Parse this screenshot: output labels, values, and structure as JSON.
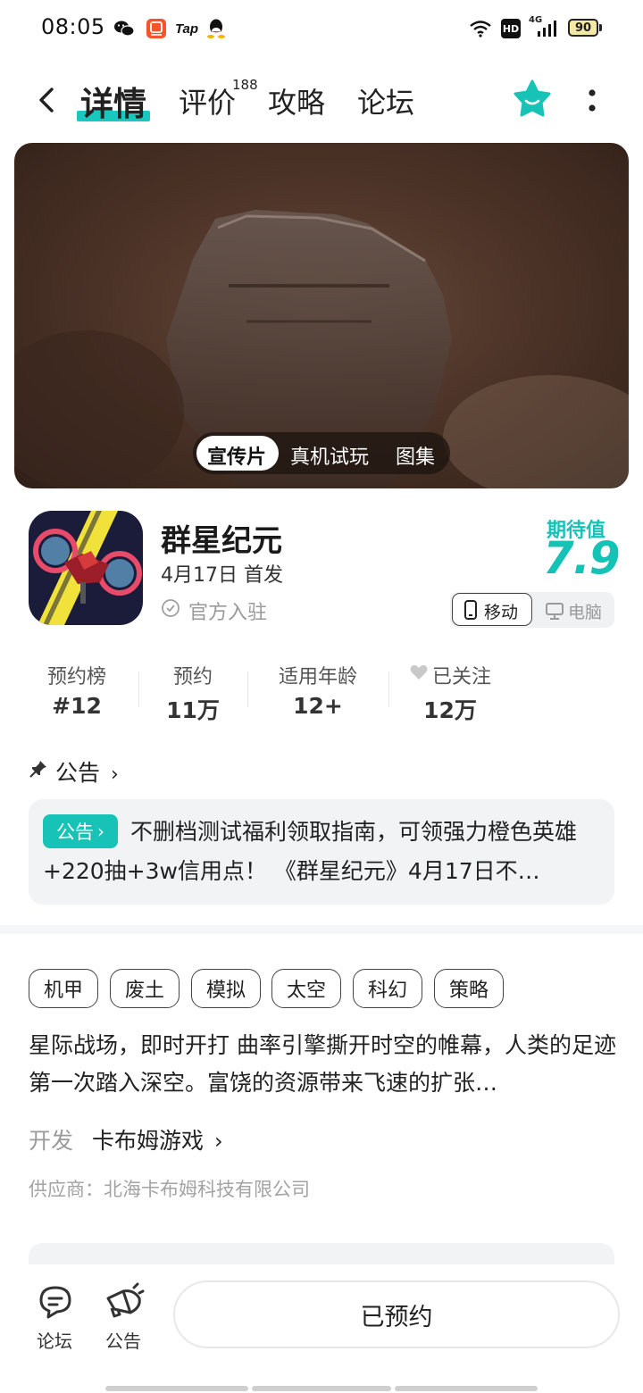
{
  "status_bar": {
    "time": "08:05",
    "left_icons": [
      "wechat-icon",
      "app-badge-icon",
      "tap-icon",
      "qq-icon"
    ],
    "tap_label": "Tap",
    "right_icons": [
      "wifi-icon",
      "hd-icon",
      "signal-4g-icon",
      "battery-icon"
    ],
    "hd_label": "HD",
    "network_label": "4G",
    "battery_level": "90"
  },
  "nav": {
    "tabs": [
      {
        "label": "详情",
        "active": true
      },
      {
        "label": "评价",
        "badge": "188"
      },
      {
        "label": "攻略"
      },
      {
        "label": "论坛"
      }
    ],
    "accent_color": "#18c7bd"
  },
  "media": {
    "tabs": [
      "宣传片",
      "真机试玩",
      "图集"
    ],
    "active_index": 0
  },
  "game": {
    "name": "群星纪元",
    "release": "4月17日 首发",
    "official": "官方入驻",
    "expectation_label": "期待值",
    "expectation_score": "7.9",
    "platforms": [
      {
        "label": "移动",
        "icon": "phone-icon",
        "active": true
      },
      {
        "label": "电脑",
        "icon": "monitor-icon",
        "active": false
      }
    ]
  },
  "stats": [
    {
      "label": "预约榜",
      "value": "#12"
    },
    {
      "label": "预约",
      "value": "11万"
    },
    {
      "label": "适用年龄",
      "value": "12+"
    },
    {
      "label": "已关注",
      "value": "12万",
      "icon": "heart-icon"
    }
  ],
  "announcement": {
    "heading": "公告",
    "tag": "公告",
    "text": "不删档测试福利领取指南，可领强力橙色英雄+220抽+3w信用点！ 《群星纪元》4月17日不…"
  },
  "tags": [
    "机甲",
    "废土",
    "模拟",
    "太空",
    "科幻",
    "策略"
  ],
  "description": "星际战场，即时开打 曲率引擎撕开时空的帷幕，人类的足迹第一次踏入深空。富饶的资源带来飞速的扩张…",
  "developer": {
    "label": "开发",
    "name": "卡布姆游戏"
  },
  "supplier": "供应商：北海卡布姆科技有限公司",
  "bottom_bar": {
    "forum": "论坛",
    "notice": "公告",
    "reserve_button": "已预约"
  }
}
